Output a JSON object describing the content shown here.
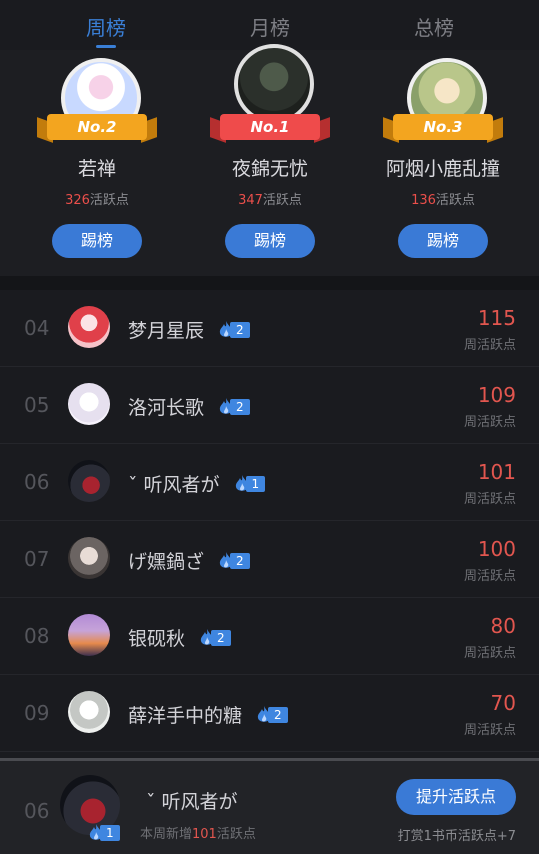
{
  "tabs": [
    {
      "label": "周榜",
      "active": true
    },
    {
      "label": "月榜",
      "active": false
    },
    {
      "label": "总榜",
      "active": false
    }
  ],
  "podium": [
    {
      "rank_label": "No.2",
      "name": "若禅",
      "score": "326",
      "score_unit": "活跃点",
      "button": "踢榜",
      "ribbon_color": "gold"
    },
    {
      "rank_label": "No.1",
      "name": "夜錦无忧",
      "score": "347",
      "score_unit": "活跃点",
      "button": "踢榜",
      "ribbon_color": "red"
    },
    {
      "rank_label": "No.3",
      "name": "阿烟小鹿乱撞",
      "score": "136",
      "score_unit": "活跃点",
      "button": "踢榜",
      "ribbon_color": "gold"
    }
  ],
  "list": [
    {
      "rank": "04",
      "name": "梦月星辰",
      "level": "2",
      "score": "115",
      "score_label": "周活跃点"
    },
    {
      "rank": "05",
      "name": "洛河长歌",
      "level": "2",
      "score": "109",
      "score_label": "周活跃点"
    },
    {
      "rank": "06",
      "name": "ˇ 听风者が",
      "level": "1",
      "score": "101",
      "score_label": "周活跃点"
    },
    {
      "rank": "07",
      "name": "げ嫼鍋ざ",
      "level": "2",
      "score": "100",
      "score_label": "周活跃点"
    },
    {
      "rank": "08",
      "name": "银砚秋",
      "level": "2",
      "score": "80",
      "score_label": "周活跃点"
    },
    {
      "rank": "09",
      "name": "薛洋手中的糖",
      "level": "2",
      "score": "70",
      "score_label": "周活跃点"
    }
  ],
  "me": {
    "rank": "06",
    "name": "ˇ 听风者が",
    "level": "1",
    "sub_prefix": "本周新增",
    "sub_value": "101",
    "sub_suffix": "活跃点",
    "boost_button": "提升活跃点",
    "hint": "打赏1书币活跃点+7"
  },
  "colors": {
    "accent": "#3a7ad6",
    "score_red": "#e2564f",
    "background": "#1a1b1f"
  }
}
